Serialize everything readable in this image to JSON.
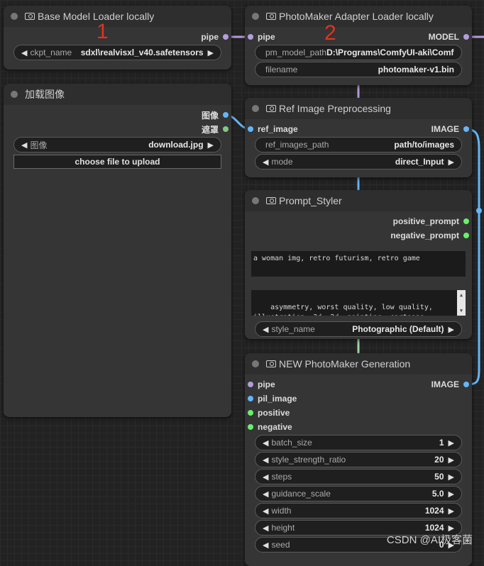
{
  "colors": {
    "canvas": "#222222",
    "node_bg": "#353535",
    "node_title_bg": "#2e2e2e",
    "model_pipe": "#b39ddb",
    "image": "#64b5f6",
    "mask": "#81c784",
    "string": "#69f069",
    "marker": "#e0331f"
  },
  "markers": {
    "one": "1",
    "two": "2"
  },
  "nodes": {
    "base_loader": {
      "title": "Base Model Loader locally",
      "outputs": {
        "pipe": "pipe"
      },
      "widgets": {
        "ckpt": {
          "label": "ckpt_name",
          "value": "sdxl\\realvisxl_v40.safetensors"
        }
      }
    },
    "adapter_loader": {
      "title": "PhotoMaker Adapter Loader locally",
      "inputs": {
        "pipe": "pipe"
      },
      "outputs": {
        "model": "MODEL"
      },
      "widgets": {
        "pm_model_path": {
          "label": "pm_model_path",
          "value": "D:\\Programs\\ComfyUI-aki\\ComfyU"
        },
        "filename": {
          "label": "filename",
          "value": "photomaker-v1.bin"
        }
      }
    },
    "load_image": {
      "title": "加载图像",
      "outputs": {
        "image": "图像",
        "mask": "遮罩"
      },
      "widgets": {
        "image": {
          "label": "图像",
          "value": "download.jpg"
        }
      },
      "upload_button": "choose file to upload"
    },
    "ref_image": {
      "title": "Ref Image Preprocessing",
      "inputs": {
        "ref_image": "ref_image"
      },
      "outputs": {
        "image": "IMAGE"
      },
      "widgets": {
        "ref_images_path": {
          "label": "ref_images_path",
          "value": "path/to/images"
        },
        "mode": {
          "label": "mode",
          "value": "direct_Input"
        }
      }
    },
    "prompt_styler": {
      "title": "Prompt_Styler",
      "outputs": {
        "positive": "positive_prompt",
        "negative": "negative_prompt"
      },
      "positive_text": "a woman img, retro futurism, retro game",
      "negative_text": "asymmetry, worst quality, low quality, illustration, 3d, 2d, painting, cartoons, sketch), open mouth",
      "widgets": {
        "style_name": {
          "label": "style_name",
          "value": "Photographic (Default)"
        }
      }
    },
    "generation": {
      "title": "NEW PhotoMaker Generation",
      "inputs": {
        "pipe": "pipe",
        "pil_image": "pil_image",
        "positive": "positive",
        "negative": "negative"
      },
      "outputs": {
        "image": "IMAGE"
      },
      "widgets": {
        "batch_size": {
          "label": "batch_size",
          "value": "1"
        },
        "style_strength_ratio": {
          "label": "style_strength_ratio",
          "value": "20"
        },
        "steps": {
          "label": "steps",
          "value": "50"
        },
        "guidance_scale": {
          "label": "guidance_scale",
          "value": "5.0"
        },
        "width": {
          "label": "width",
          "value": "1024"
        },
        "height": {
          "label": "height",
          "value": "1024"
        },
        "seed": {
          "label": "seed",
          "value": "0"
        }
      }
    }
  },
  "watermark": "CSDN @AI极客菌"
}
